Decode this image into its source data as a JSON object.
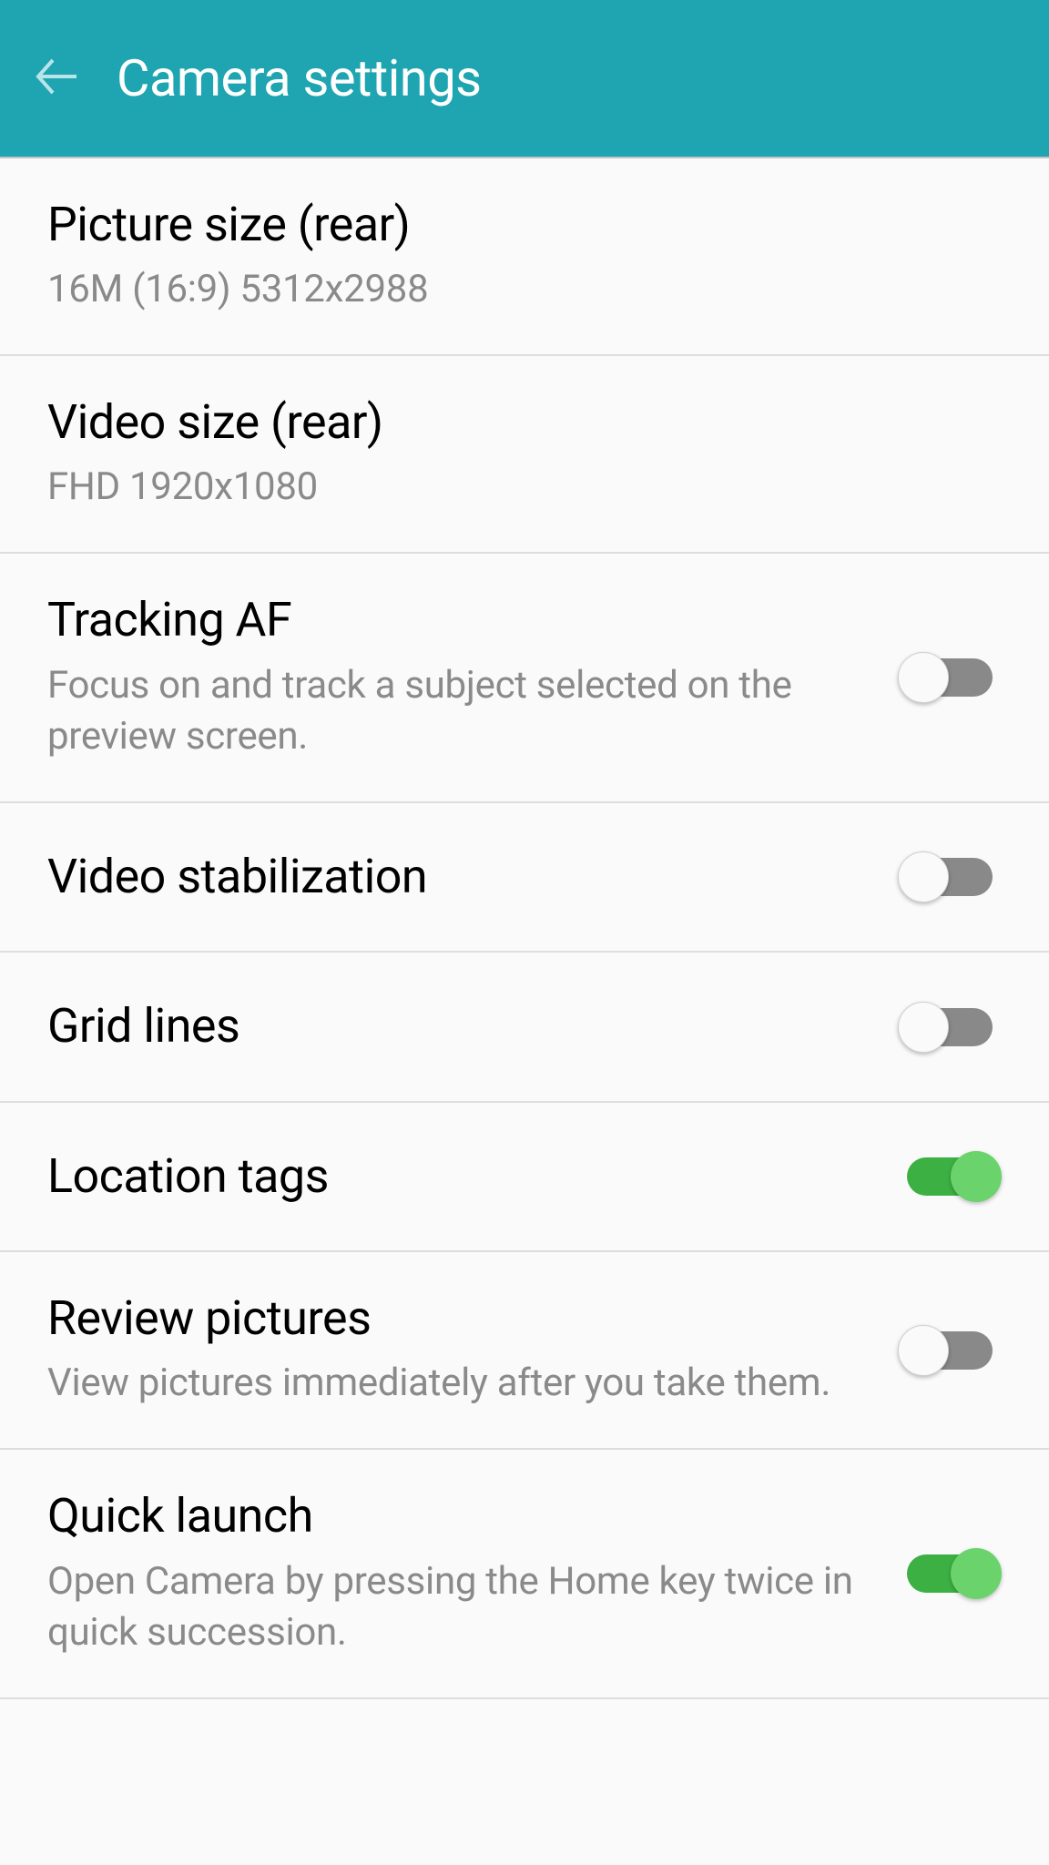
{
  "header": {
    "title": "Camera settings"
  },
  "settings": {
    "picture_size": {
      "title": "Picture size (rear)",
      "value": "16M (16:9) 5312x2988"
    },
    "video_size": {
      "title": "Video size (rear)",
      "value": "FHD 1920x1080"
    },
    "tracking_af": {
      "title": "Tracking AF",
      "description": "Focus on and track a subject selected on the preview screen."
    },
    "video_stabilization": {
      "title": "Video stabilization"
    },
    "grid_lines": {
      "title": "Grid lines"
    },
    "location_tags": {
      "title": "Location tags"
    },
    "review_pictures": {
      "title": "Review pictures",
      "description": "View pictures immediately after you take them."
    },
    "quick_launch": {
      "title": "Quick launch",
      "description": "Open Camera by pressing the Home key twice in quick succession."
    }
  },
  "toggle_states": {
    "tracking_af": false,
    "video_stabilization": false,
    "grid_lines": false,
    "location_tags": true,
    "review_pictures": false,
    "quick_launch": true
  }
}
